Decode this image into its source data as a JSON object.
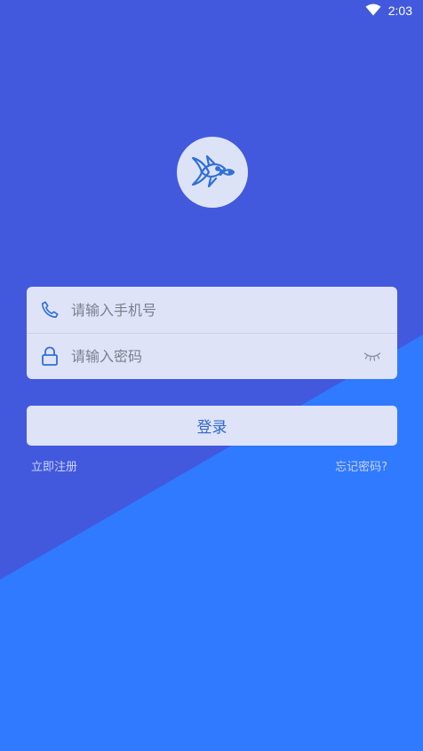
{
  "colors": {
    "background_top": "#4259dd",
    "background_bottom": "#2f7aff",
    "card": "#dfe3f8",
    "accent": "#3168c8"
  },
  "status_bar": {
    "time": "2:03",
    "icons": [
      "wifi-icon"
    ]
  },
  "logo": {
    "icon": "fish-icon"
  },
  "form": {
    "phone": {
      "icon": "phone-icon",
      "placeholder": "请输入手机号",
      "value": ""
    },
    "password": {
      "icon": "lock-icon",
      "placeholder": "请输入密码",
      "value": "",
      "toggle_icon": "eye-closed-icon"
    }
  },
  "login_button": {
    "label": "登录"
  },
  "links": {
    "register": "立即注册",
    "forgot_password": "忘记密码?"
  }
}
